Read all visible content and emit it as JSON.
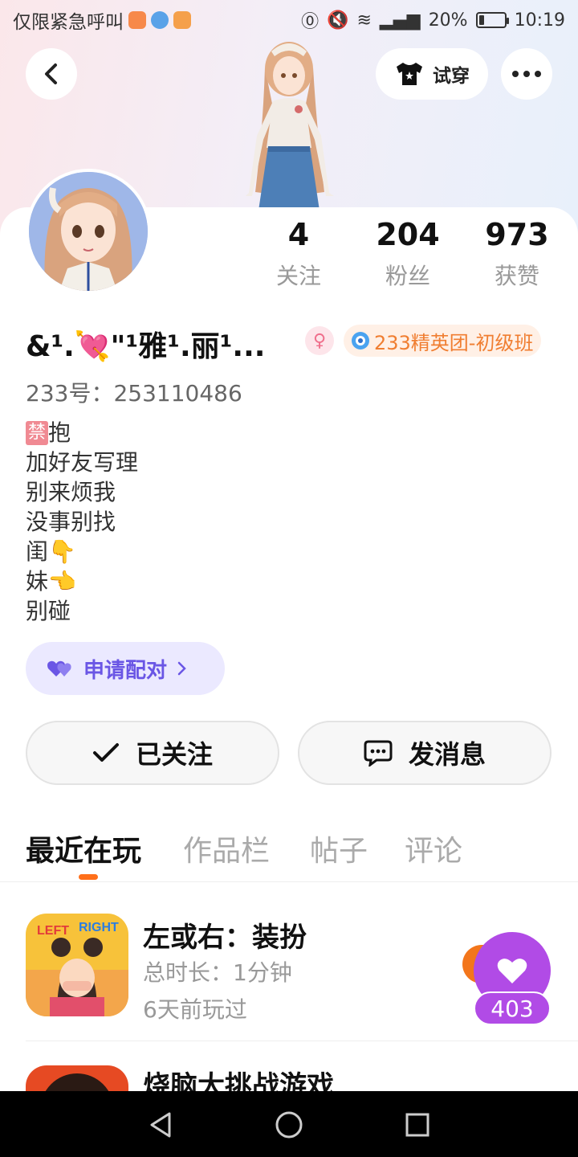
{
  "status_bar": {
    "carrier": "仅限紧急呼叫",
    "battery": "20%",
    "battery_level": 0.2,
    "time": "10:19"
  },
  "header": {
    "back_icon": "chevron-left-icon",
    "try_on_label": "试穿",
    "more_icon": "more-dots-icon"
  },
  "profile": {
    "stats": [
      {
        "value": "4",
        "label": "关注"
      },
      {
        "value": "204",
        "label": "粉丝"
      },
      {
        "value": "973",
        "label": "获赞"
      }
    ],
    "name": "&¹.💘\"¹雅¹.丽¹...",
    "gender_symbol": "♀",
    "badge": "233精英团-初级班",
    "uid": "233号：253110486",
    "bio_lines": [
      "抱",
      "加好友写理",
      "别来烦我",
      "没事别找",
      "闺👇",
      "妹👈",
      "别碰"
    ],
    "bio_prefix_badge": "禁",
    "pair_button": "申请配对",
    "follow_button": "已关注",
    "message_button": "发消息"
  },
  "tabs": [
    "最近在玩",
    "作品栏",
    "帖子",
    "评论"
  ],
  "games": [
    {
      "title": "左或右：装扮",
      "duration": "总时长：1分钟",
      "played": "6天前玩过",
      "thumb_text_left": "LEFT",
      "thumb_text_right": "RIGHT"
    },
    {
      "title": "烧脑大挑战游戏",
      "duration": "",
      "played": ""
    }
  ],
  "like_fab": {
    "count": "403"
  },
  "colors": {
    "accent_orange": "#ff6f1a",
    "pair_purple": "#6a56e5",
    "like_purple": "#b14be6",
    "badge_orange": "#f07e31"
  }
}
